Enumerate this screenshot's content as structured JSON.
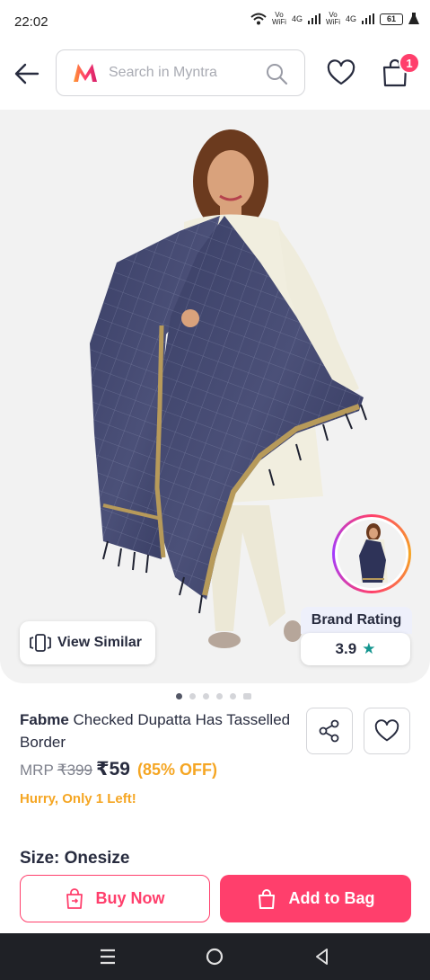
{
  "status_bar": {
    "time": "22:02",
    "net1_top": "Vo",
    "net1_bottom": "WiFi",
    "net2": "4G",
    "net3_top": "Vo",
    "net3_bottom": "WiFi",
    "net4": "4G",
    "battery": "61"
  },
  "header": {
    "search_placeholder": "Search in Myntra",
    "bag_count": "1"
  },
  "hero": {
    "view_similar_label": "View Similar",
    "brand_rating_title": "Brand Rating",
    "brand_rating_value": "3.9",
    "image_count": 6,
    "active_image_index": 0
  },
  "product": {
    "brand": "Fabme",
    "name": " Checked Dupatta Has Tasselled Border",
    "mrp_label": "MRP",
    "mrp_value": "₹399",
    "price": "₹59",
    "discount": "(85% OFF)",
    "stock_message": "Hurry, Only 1 Left!",
    "size_label": "Size: Onesize"
  },
  "actions": {
    "buy_now_label": "Buy Now",
    "add_to_bag_label": "Add to Bag"
  },
  "colors": {
    "accent": "#ff3f6c",
    "discount": "#f5a623",
    "rating_star": "#14958f",
    "text_primary": "#282c3f",
    "text_muted": "#7e818c"
  },
  "icons": {
    "back": "arrow-left-icon",
    "search": "search-icon",
    "wishlist": "heart-icon",
    "bag": "shopping-bag-icon",
    "view_similar": "similar-cards-icon",
    "star": "star-icon",
    "share": "share-icon",
    "buy_now": "buy-bag-icon",
    "add_to_bag": "bag-icon"
  }
}
